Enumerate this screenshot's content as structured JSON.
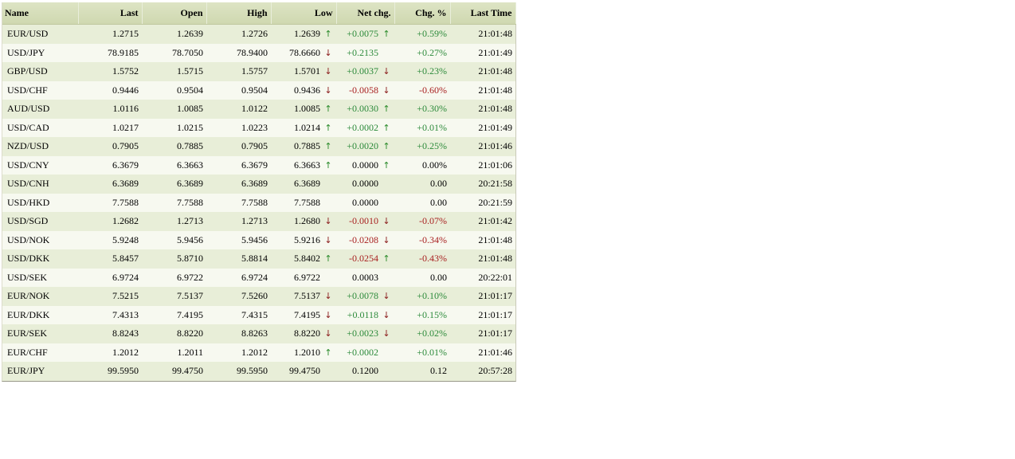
{
  "colors": {
    "header_bg": "#d4dcb8",
    "row_odd": "#e8eed8",
    "row_even": "#f7f9f0",
    "positive": "#2c8a3a",
    "negative": "#a82020",
    "arrow_up": "#2a8a2a",
    "arrow_down": "#8a1a1a"
  },
  "table": {
    "headers": [
      "Name",
      "Last",
      "Open",
      "High",
      "Low",
      "Net chg.",
      "Chg. %",
      "Last Time"
    ],
    "rows": [
      {
        "name": "EUR/USD",
        "last": "1.2715",
        "open": "1.2639",
        "high": "1.2726",
        "low": "1.2639",
        "low_arrow": "up",
        "net": "+0.0075",
        "net_arrow": "up",
        "pct": "+0.59%",
        "time": "21:01:48",
        "tone": "pos"
      },
      {
        "name": "USD/JPY",
        "last": "78.9185",
        "open": "78.7050",
        "high": "78.9400",
        "low": "78.6660",
        "low_arrow": "down",
        "net": "+0.2135",
        "net_arrow": "",
        "pct": "+0.27%",
        "time": "21:01:49",
        "tone": "pos"
      },
      {
        "name": "GBP/USD",
        "last": "1.5752",
        "open": "1.5715",
        "high": "1.5757",
        "low": "1.5701",
        "low_arrow": "down",
        "net": "+0.0037",
        "net_arrow": "down",
        "pct": "+0.23%",
        "time": "21:01:48",
        "tone": "pos"
      },
      {
        "name": "USD/CHF",
        "last": "0.9446",
        "open": "0.9504",
        "high": "0.9504",
        "low": "0.9436",
        "low_arrow": "down",
        "net": "-0.0058",
        "net_arrow": "down",
        "pct": "-0.60%",
        "time": "21:01:48",
        "tone": "neg"
      },
      {
        "name": "AUD/USD",
        "last": "1.0116",
        "open": "1.0085",
        "high": "1.0122",
        "low": "1.0085",
        "low_arrow": "up",
        "net": "+0.0030",
        "net_arrow": "up",
        "pct": "+0.30%",
        "time": "21:01:48",
        "tone": "pos"
      },
      {
        "name": "USD/CAD",
        "last": "1.0217",
        "open": "1.0215",
        "high": "1.0223",
        "low": "1.0214",
        "low_arrow": "up",
        "net": "+0.0002",
        "net_arrow": "up",
        "pct": "+0.01%",
        "time": "21:01:49",
        "tone": "pos"
      },
      {
        "name": "NZD/USD",
        "last": "0.7905",
        "open": "0.7885",
        "high": "0.7905",
        "low": "0.7885",
        "low_arrow": "up",
        "net": "+0.0020",
        "net_arrow": "up",
        "pct": "+0.25%",
        "time": "21:01:46",
        "tone": "pos"
      },
      {
        "name": "USD/CNY",
        "last": "6.3679",
        "open": "6.3663",
        "high": "6.3679",
        "low": "6.3663",
        "low_arrow": "up",
        "net": "0.0000",
        "net_arrow": "up",
        "pct": "0.00%",
        "time": "21:01:06",
        "tone": "neu"
      },
      {
        "name": "USD/CNH",
        "last": "6.3689",
        "open": "6.3689",
        "high": "6.3689",
        "low": "6.3689",
        "low_arrow": "",
        "net": "0.0000",
        "net_arrow": "",
        "pct": "0.00",
        "time": "20:21:58",
        "tone": "neu"
      },
      {
        "name": "USD/HKD",
        "last": "7.7588",
        "open": "7.7588",
        "high": "7.7588",
        "low": "7.7588",
        "low_arrow": "",
        "net": "0.0000",
        "net_arrow": "",
        "pct": "0.00",
        "time": "20:21:59",
        "tone": "neu"
      },
      {
        "name": "USD/SGD",
        "last": "1.2682",
        "open": "1.2713",
        "high": "1.2713",
        "low": "1.2680",
        "low_arrow": "down",
        "net": "-0.0010",
        "net_arrow": "down",
        "pct": "-0.07%",
        "time": "21:01:42",
        "tone": "neg"
      },
      {
        "name": "USD/NOK",
        "last": "5.9248",
        "open": "5.9456",
        "high": "5.9456",
        "low": "5.9216",
        "low_arrow": "down",
        "net": "-0.0208",
        "net_arrow": "down",
        "pct": "-0.34%",
        "time": "21:01:48",
        "tone": "neg"
      },
      {
        "name": "USD/DKK",
        "last": "5.8457",
        "open": "5.8710",
        "high": "5.8814",
        "low": "5.8402",
        "low_arrow": "up",
        "net": "-0.0254",
        "net_arrow": "up",
        "pct": "-0.43%",
        "time": "21:01:48",
        "tone": "neg"
      },
      {
        "name": "USD/SEK",
        "last": "6.9724",
        "open": "6.9722",
        "high": "6.9724",
        "low": "6.9722",
        "low_arrow": "",
        "net": "0.0003",
        "net_arrow": "",
        "pct": "0.00",
        "time": "20:22:01",
        "tone": "neu"
      },
      {
        "name": "EUR/NOK",
        "last": "7.5215",
        "open": "7.5137",
        "high": "7.5260",
        "low": "7.5137",
        "low_arrow": "down",
        "net": "+0.0078",
        "net_arrow": "down",
        "pct": "+0.10%",
        "time": "21:01:17",
        "tone": "pos"
      },
      {
        "name": "EUR/DKK",
        "last": "7.4313",
        "open": "7.4195",
        "high": "7.4315",
        "low": "7.4195",
        "low_arrow": "down",
        "net": "+0.0118",
        "net_arrow": "down",
        "pct": "+0.15%",
        "time": "21:01:17",
        "tone": "pos"
      },
      {
        "name": "EUR/SEK",
        "last": "8.8243",
        "open": "8.8220",
        "high": "8.8263",
        "low": "8.8220",
        "low_arrow": "down",
        "net": "+0.0023",
        "net_arrow": "down",
        "pct": "+0.02%",
        "time": "21:01:17",
        "tone": "pos"
      },
      {
        "name": "EUR/CHF",
        "last": "1.2012",
        "open": "1.2011",
        "high": "1.2012",
        "low": "1.2010",
        "low_arrow": "up",
        "net": "+0.0002",
        "net_arrow": "",
        "pct": "+0.01%",
        "time": "21:01:46",
        "tone": "pos"
      },
      {
        "name": "EUR/JPY",
        "last": "99.5950",
        "open": "99.4750",
        "high": "99.5950",
        "low": "99.4750",
        "low_arrow": "",
        "net": "0.1200",
        "net_arrow": "",
        "pct": "0.12",
        "time": "20:57:28",
        "tone": "neu"
      }
    ]
  }
}
